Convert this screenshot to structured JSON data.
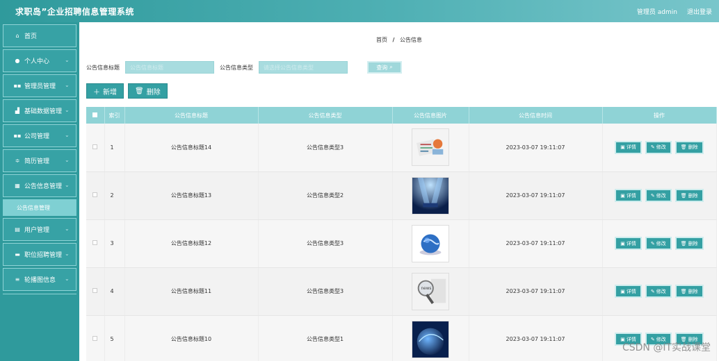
{
  "header": {
    "title": "求职岛”企业招聘信息管理系统",
    "admin_label": "管理员 admin",
    "logout_label": "退出登录"
  },
  "sidebar": {
    "items": [
      {
        "label": "首页",
        "icon": "home-icon"
      },
      {
        "label": "个人中心",
        "icon": "user-icon"
      },
      {
        "label": "管理员管理",
        "icon": "grid-icon"
      },
      {
        "label": "基础数据管理",
        "icon": "chart-icon"
      },
      {
        "label": "公司管理",
        "icon": "grid-icon"
      },
      {
        "label": "简历管理",
        "icon": "sliders-icon"
      },
      {
        "label": "公告信息管理",
        "icon": "list-icon"
      }
    ],
    "active_sub": "公告信息管理",
    "items_after": [
      {
        "label": "用户管理",
        "icon": "table-icon"
      },
      {
        "label": "职位招聘管理",
        "icon": "monitor-icon"
      },
      {
        "label": "轮播图信息",
        "icon": "menu-icon"
      }
    ]
  },
  "breadcrumb": {
    "home": "首页",
    "sep": "/",
    "current": "公告信息"
  },
  "search": {
    "title_label": "公告信息标题",
    "title_placeholder": "公告信息标题",
    "type_label": "公告信息类型",
    "type_placeholder": "请选择公告信息类型",
    "query_label": "查询"
  },
  "actions": {
    "add_label": "新增",
    "delete_label": "删除"
  },
  "table": {
    "headers": [
      "索引",
      "公告信息标题",
      "公告信息类型",
      "公告信息图片",
      "公告信息时间",
      "操作"
    ],
    "rows": [
      {
        "index": "1",
        "title": "公告信息标题14",
        "type": "公告信息类型3",
        "time": "2023-03-07 19:11:07"
      },
      {
        "index": "2",
        "title": "公告信息标题13",
        "type": "公告信息类型2",
        "time": "2023-03-07 19:11:07"
      },
      {
        "index": "3",
        "title": "公告信息标题12",
        "type": "公告信息类型3",
        "time": "2023-03-07 19:11:07"
      },
      {
        "index": "4",
        "title": "公告信息标题11",
        "type": "公告信息类型3",
        "time": "2023-03-07 19:11:07"
      },
      {
        "index": "5",
        "title": "公告信息标题10",
        "type": "公告信息类型1",
        "time": "2023-03-07 19:11:07"
      }
    ],
    "op_labels": {
      "detail": "详情",
      "edit": "修改",
      "delete": "删除"
    }
  },
  "watermark": "CSDN @IT实战课堂",
  "colors": {
    "primary": "#34a0a3",
    "header_light": "#8fd3d6",
    "sidebar": "#2f9a9c"
  }
}
